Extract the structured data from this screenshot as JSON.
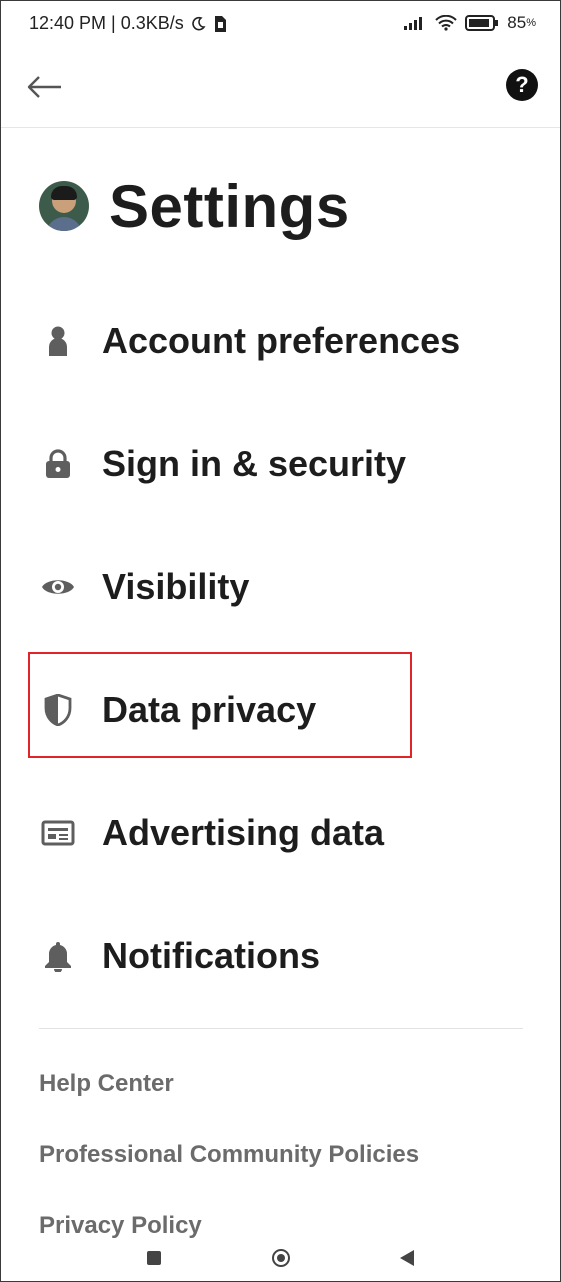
{
  "status_bar": {
    "time_speed": "12:40 PM | 0.3KB/s",
    "battery": "85"
  },
  "header": {
    "title": "Settings"
  },
  "menu": {
    "items": [
      {
        "label": "Account preferences",
        "icon": "person-icon"
      },
      {
        "label": "Sign in & security",
        "icon": "lock-icon"
      },
      {
        "label": "Visibility",
        "icon": "eye-icon"
      },
      {
        "label": "Data privacy",
        "icon": "shield-icon"
      },
      {
        "label": "Advertising data",
        "icon": "newspaper-icon"
      },
      {
        "label": "Notifications",
        "icon": "bell-icon"
      }
    ]
  },
  "footer": {
    "links": [
      "Help Center",
      "Professional Community Policies",
      "Privacy Policy"
    ]
  },
  "colors": {
    "highlight": "#e0242b",
    "text": "#1d1d1d",
    "icon": "#5e5e5e",
    "footer_text": "#6b6b6b"
  }
}
